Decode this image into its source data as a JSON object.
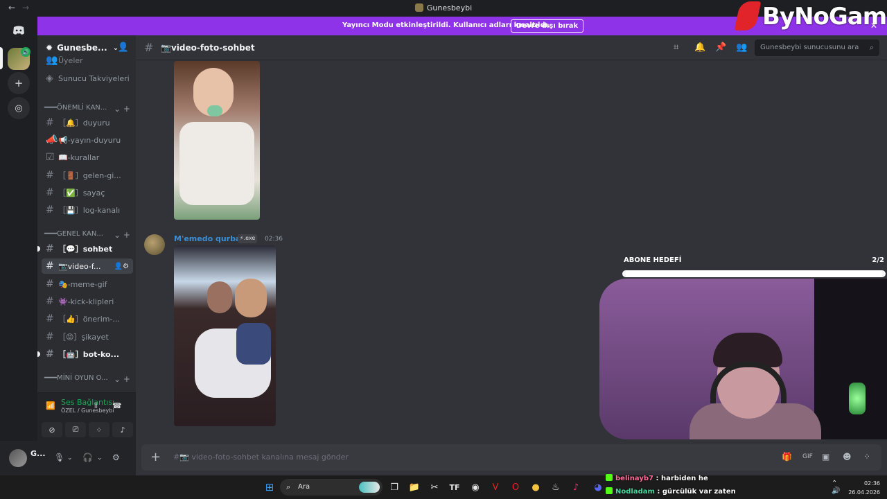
{
  "window": {
    "title": "Gunesbeybi",
    "back": "←",
    "forward": "→"
  },
  "banner": {
    "text": "Yayıncı Modu etkinleştirildi. Kullanıcı adları kısaltıldı.",
    "button": "Devre dışı bırak"
  },
  "logo": {
    "text": "ByNoGame"
  },
  "server": {
    "name": "Gunesbe...",
    "members_label": "Üyeler",
    "boosts_label": "Sunucu Takviyeleri"
  },
  "categories": [
    {
      "label": "━━━ÖNEMLİ KAN..."
    },
    {
      "label": "━━━GENEL KAN..."
    },
    {
      "label": "━━━MİNİ OYUN O..."
    }
  ],
  "channels": [
    {
      "label": "［🔔］duyuru"
    },
    {
      "label": "📢-yayın-duyuru"
    },
    {
      "label": "📖-kurallar"
    },
    {
      "label": "［🚪］gelen-gi..."
    },
    {
      "label": "［✅］sayaç"
    },
    {
      "label": "［💾］log-kanalı"
    },
    {
      "label": "［💬］sohbet"
    },
    {
      "label": "📷video-f..."
    },
    {
      "label": "🎭-meme-gif"
    },
    {
      "label": "👾-kick-klipleri"
    },
    {
      "label": "［👍］önerim-..."
    },
    {
      "label": "［😡］şikayet"
    },
    {
      "label": "［🤖］bot-ko..."
    }
  ],
  "voice": {
    "status": "Ses Bağlantısı K",
    "location": "ÖZEL / Gunesbeybi"
  },
  "user": {
    "name": "G..."
  },
  "channel_header": {
    "name": "📷video-foto-sohbet",
    "search_placeholder": "Gunesbeybi sunucusunu ara"
  },
  "message": {
    "author": "M'emedo qurbaN",
    "tag": "⚡.exe",
    "time": "02:36"
  },
  "composer": {
    "placeholder": "#📷 video-foto-sohbet kanalına mesaj gönder"
  },
  "overlay": {
    "goal_label": "ABONE HEDEFİ",
    "goal_count": "2/2",
    "goal_progress": 1.0
  },
  "stream_chat": [
    {
      "user": "belinayb7",
      "text": " : harbiden he"
    },
    {
      "user": "Nodladam",
      "text": " : gürcülük var zaten"
    }
  ],
  "taskbar": {
    "search": "Ara",
    "time": "02:36",
    "date": "26.04.2026"
  },
  "colors": {
    "banner": "#8e33e8",
    "author": "#3b8fd8",
    "voice_green": "#23a55a"
  }
}
